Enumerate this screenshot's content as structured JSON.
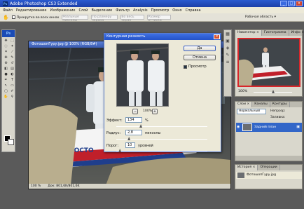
{
  "app": {
    "title": "Adobe Photoshop CS3 Extended",
    "logo": "Ps"
  },
  "window_buttons": {
    "minimize": "_",
    "maximize": "□",
    "close": "×"
  },
  "menu": [
    "Файл",
    "Редактирование",
    "Изображение",
    "Слой",
    "Выделение",
    "Фильтр",
    "Analysis",
    "Просмотр",
    "Окно",
    "Справка"
  ],
  "options_bar": {
    "checkbox_label": "Прокрутка во всех окнах",
    "btn_actual": "Реальные пикселы",
    "btn_fit": "По размеру экрана",
    "btn_fill": "Во весь экран",
    "btn_print": "Размер оттиска",
    "workspace": "Рабочая область ▾"
  },
  "document": {
    "title": "ФотошопГуру.jpg @ 100% (RGB/8#)",
    "zoom": "100 %",
    "doc_size": "Док: 801,6K/801,6K",
    "photo_text": "РОСТО"
  },
  "dialog": {
    "title": "Контурная резкость",
    "ok": "Да",
    "cancel": "Отмена",
    "preview_label": "Просмотр",
    "preview_checked": true,
    "zoom": "100%",
    "zoom_minus": "−",
    "zoom_plus": "+",
    "amount_label": "Эффект:",
    "amount_value": "134",
    "amount_unit": "%",
    "radius_label": "Радиус:",
    "radius_value": "2,8",
    "radius_unit": "пикселы",
    "threshold_label": "Порог:",
    "threshold_value": "10",
    "threshold_unit": "уровней",
    "amount_fraction": 0.27,
    "radius_fraction": 0.14,
    "threshold_fraction": 0.04
  },
  "navigator": {
    "tabs": [
      "Навигатор ×",
      "Гистограмма",
      "Инфо ×"
    ],
    "zoom": "100%"
  },
  "layers": {
    "tabs": [
      "Слои ×",
      "Каналы",
      "Контуры"
    ],
    "blend_mode": "Нормальный",
    "opacity_label": "Непрозр:",
    "fill_label": "Заливка:",
    "layer_name": "Задний план"
  },
  "history": {
    "tabs": [
      "История ×",
      "Операции"
    ],
    "item": "ФотошопГуру.jpg"
  },
  "colors": {
    "title_blue": "#1c3fa8",
    "dialog_title": "#2452c8",
    "panel_bg": "#d9d7cc",
    "close_red": "#d8512f"
  },
  "tool_icons": [
    "move-icon",
    "marquee-icon",
    "lasso-icon",
    "magic-wand-icon",
    "crop-icon",
    "slice-icon",
    "healing-icon",
    "brush-icon",
    "stamp-icon",
    "history-brush-icon",
    "eraser-icon",
    "gradient-icon",
    "blur-icon",
    "dodge-icon",
    "pen-icon",
    "type-icon",
    "path-select-icon",
    "shape-icon",
    "notes-icon",
    "eyedropper-icon",
    "hand-icon",
    "zoom-icon"
  ],
  "tool_glyphs": [
    "✥",
    "⬚",
    "◌",
    "✦",
    "⌗",
    "⟋",
    "✚",
    "✎",
    "⊕",
    "↺",
    "◧",
    "▤",
    "●",
    "◐",
    "✒",
    "T",
    "↖",
    "▭",
    "▢",
    "✐",
    "✋",
    "⚲"
  ],
  "right_icons": {
    "glyphs": [
      "▦",
      "▣",
      "◈",
      "✎",
      "≡"
    ],
    "names": [
      "histogram-icon",
      "color-icon",
      "swatches-icon",
      "brush-preset-icon",
      "layers-icon"
    ]
  }
}
